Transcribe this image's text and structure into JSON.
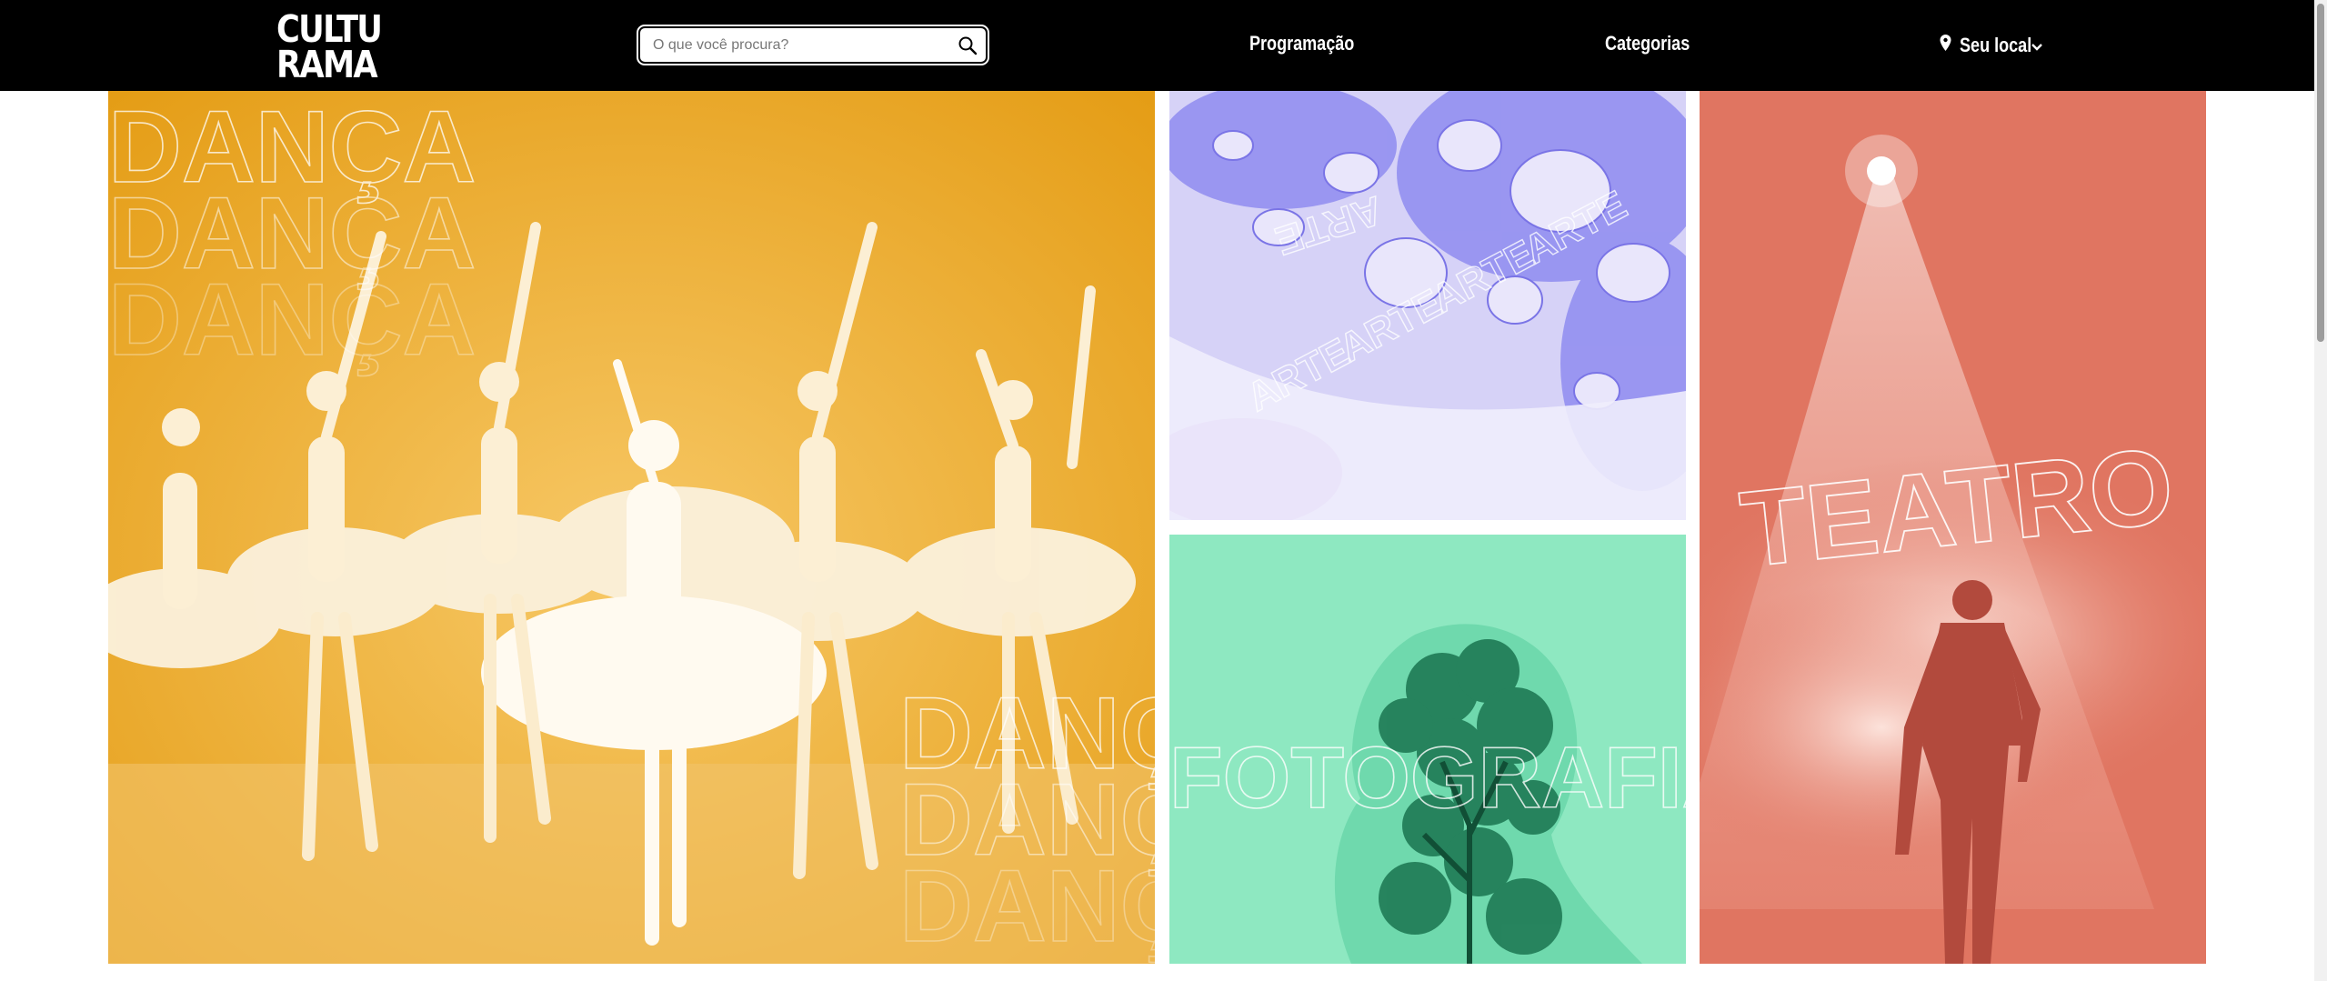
{
  "header": {
    "logo": {
      "line1": "CULTU",
      "line2": "RAMA",
      "icon": "culturama-logo"
    },
    "search": {
      "placeholder": "O que você procura?",
      "icon": "search-icon"
    },
    "nav": {
      "programacao": "Programação",
      "categorias": "Categorias"
    },
    "location": {
      "label": "Seu local",
      "icons": [
        "pin-icon",
        "chevron-down-icon"
      ]
    }
  },
  "tiles": {
    "danca": {
      "word": "DANÇA",
      "color": "#e8a51f"
    },
    "arte": {
      "word": "ARTE",
      "color": "#c9c4f4"
    },
    "fotografia": {
      "word": "FOTOGRAFIA",
      "color": "#8de6bf"
    },
    "teatro": {
      "word": "TEATRO",
      "color": "#e07561"
    }
  },
  "colors": {
    "header_bg": "#000000",
    "page_bg": "#ffffff"
  }
}
